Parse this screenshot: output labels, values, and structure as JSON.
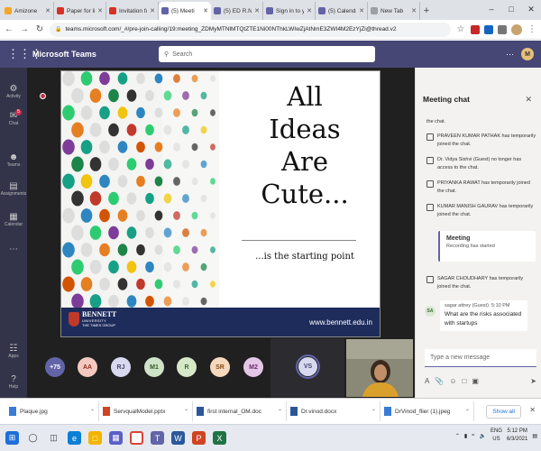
{
  "browser": {
    "tabs": [
      {
        "label": "Amizone",
        "color": "#f5a623"
      },
      {
        "label": "Paper for litera",
        "color": "#d93025"
      },
      {
        "label": "Invitation for",
        "color": "#d93025"
      },
      {
        "label": "(5) Meeti",
        "color": "#6264a7",
        "active": true
      },
      {
        "label": "(5) ED R.NO",
        "color": "#6264a7"
      },
      {
        "label": "Sign in to you",
        "color": "#6264a7"
      },
      {
        "label": "(5) Calendar",
        "color": "#6264a7"
      },
      {
        "label": "New Tab",
        "color": "#9aa0a6"
      }
    ],
    "url": "teams.microsoft.com/_#/pre-join-calling/19:meeting_ZDMyMTNlMTQtZTE1Ni00NThkLWIwZjAtNmE3ZWI4M2EzYjZi@thread.v2"
  },
  "teams": {
    "brand": "Microsoft Teams",
    "search_placeholder": "Search",
    "me_initial": "M",
    "rail": [
      {
        "label": "Activity",
        "icon": "bell-icon"
      },
      {
        "label": "Chat",
        "icon": "chat-icon",
        "badge": "5"
      },
      {
        "label": "Teams",
        "icon": "teams-icon"
      },
      {
        "label": "Assignments",
        "icon": "assignments-icon"
      },
      {
        "label": "Calendar",
        "icon": "calendar-icon"
      },
      {
        "label": "...",
        "icon": "more-icon"
      },
      {
        "label": "Apps",
        "icon": "apps-icon"
      },
      {
        "label": "Help",
        "icon": "help-icon"
      }
    ]
  },
  "slide": {
    "title_lines": [
      "All",
      "Ideas",
      "Are",
      "Cute..."
    ],
    "subtitle": "...is the starting point",
    "logo_name": "BENNETT",
    "logo_sub": "UNIVERSITY",
    "logo_group": "THE TIMES GROUP",
    "site": "www.bennett.edu.in"
  },
  "participants": [
    {
      "initials": "+75",
      "bg": "#6264a7",
      "fg": "#ffffff"
    },
    {
      "initials": "AA",
      "bg": "#f4c9c0",
      "fg": "#8a2e1c"
    },
    {
      "initials": "RJ",
      "bg": "#d8d9ee",
      "fg": "#464775"
    },
    {
      "initials": "M1",
      "bg": "#cfe3c8",
      "fg": "#2f5f23"
    },
    {
      "initials": "R",
      "bg": "#d6e8c8",
      "fg": "#3a6b2e"
    },
    {
      "initials": "SR",
      "bg": "#f6d9bd",
      "fg": "#8a4a14"
    },
    {
      "initials": "M2",
      "bg": "#e4c6e6",
      "fg": "#6b2a70"
    }
  ],
  "speaker_initials": "VS",
  "chat": {
    "title": "Meeting chat",
    "top_fragment": "the chat.",
    "events": [
      {
        "name": "PRAVEEN KUMAR PATHAK",
        "text": "has temporarily joined the chat."
      },
      {
        "name": "Dr. Vidya Sishvi (Guest)",
        "text": "no longer has access to the chat."
      },
      {
        "name": "PRIYANKA RAWAT",
        "text": "has temporarily joined the chat."
      },
      {
        "name": "KUMAR MANISH GAURAV",
        "text": "has temporarily joined the chat."
      }
    ],
    "meeting_card": {
      "title": "Meeting",
      "status": "Recording has started"
    },
    "late_event": {
      "name": "SAGAR CHOUDHARY",
      "text": "has temporarily joined the chat."
    },
    "message": {
      "avatar": "SA",
      "sender": "sagar attrey (Guest)",
      "time": "5:10 PM",
      "text": "What are the risks associated with startups"
    },
    "compose_placeholder": "Type a new message"
  },
  "downloads": [
    {
      "name": "Plaque.jpg",
      "color": "#3a7bd5"
    },
    {
      "name": "ServqualModel.pptx",
      "color": "#d04423"
    },
    {
      "name": "first internal_OM.doc",
      "color": "#2b579a"
    },
    {
      "name": "Dr.vinod.docx",
      "color": "#2b579a"
    },
    {
      "name": "DrVinod_flier (1).jpeg",
      "color": "#3a7bd5"
    }
  ],
  "downloads_show_all": "Show all",
  "taskbar": {
    "lang": "ENG",
    "region": "US",
    "time": "5:12 PM",
    "date": "6/3/2021"
  }
}
